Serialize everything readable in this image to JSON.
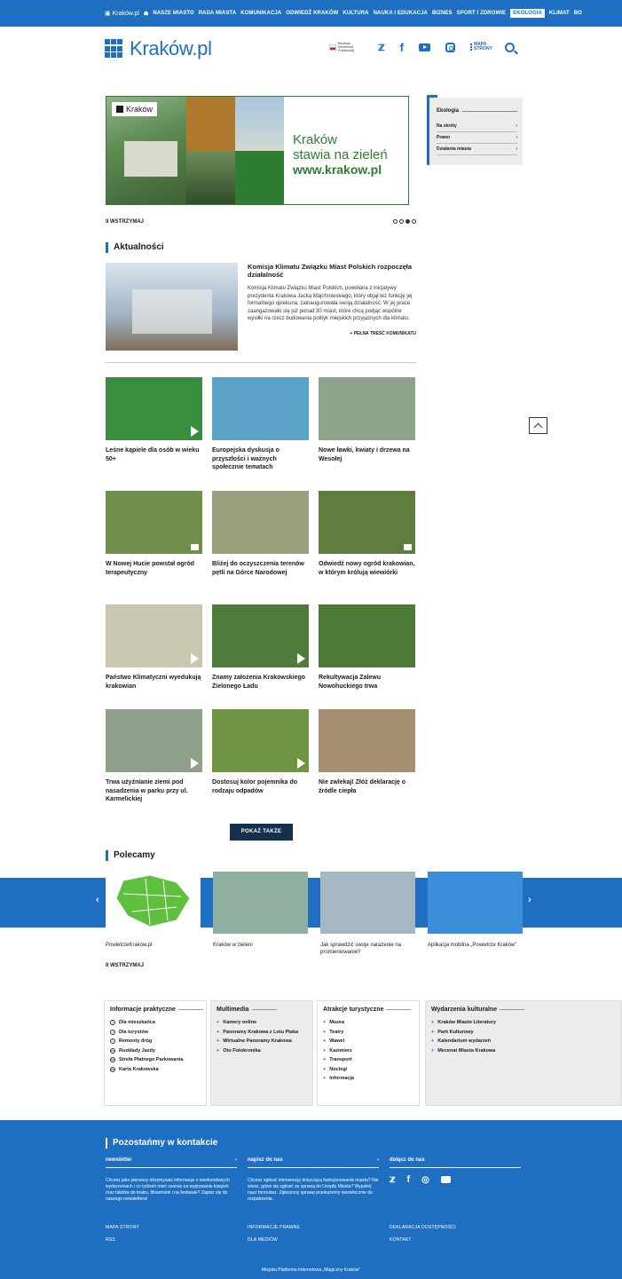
{
  "topnav": {
    "home": "Kraków.pl",
    "items": [
      "NASZE MIASTO",
      "RADA MIASTA",
      "KOMUNIKACJA",
      "ODWIEDŹ KRAKÓW",
      "KULTURA",
      "NAUKA I EDUKACJA",
      "BIZNES",
      "SPORT I ZDROWIE",
      "EKOLOGIA",
      "KLIMAT",
      "BO"
    ],
    "active": "EKOLOGIA"
  },
  "header": {
    "logo": "Kraków.pl",
    "bip": "Biuletyn Informacji Publicznej",
    "mapa": "MAPA STRONY",
    "icons": [
      "bip-icon",
      "twitter-icon",
      "facebook-icon",
      "youtube-icon",
      "instagram-icon",
      "sitemap-icon",
      "search-icon"
    ]
  },
  "banner": {
    "logo": "Kraków",
    "line1": "Kraków",
    "line2": "stawia na zieleń",
    "url": "www.krakow.pl",
    "pause": "II WSTRZYMAJ",
    "dots": 4,
    "active_dot": 3
  },
  "side": {
    "title": "Ekologia",
    "items": [
      "Na skróty",
      "Prawo",
      "Działania miasta"
    ]
  },
  "news": {
    "title": "Aktualności",
    "featured": {
      "title": "Komisja Klimatu Związku Miast Polskich rozpoczęła działalność",
      "text": "Komisja Klimatu Związku Miast Polskich, powołana z inicjatywy prezydenta Krakowa Jacka Majchrowskiego, który objął też funkcję jej formalnego opiekuna, zainaugurowała swoją działalność. W jej prace zaangażowało się już ponad 30 miast, które chcą podjąć wspólne wysiłki na rzecz budowania polityk miejskich przyjaznych dla klimatu.",
      "more": "+ PEŁNA TREŚĆ KOMUNIKATU"
    },
    "tiles": [
      {
        "title": "Leśne kąpiele dla osób w wieku 50+",
        "color": "#3a8d3f",
        "icon": "play"
      },
      {
        "title": "Europejska dyskusja o przyszłości i ważnych społecznie tematach",
        "color": "#5aa3c7",
        "icon": ""
      },
      {
        "title": "Nowe ławki, kwiaty i drzewa na Wesołej",
        "color": "#8ea48a",
        "icon": ""
      },
      {
        "title": "W Nowej Hucie powstał ogród terapeutyczny",
        "color": "#6f8f4a",
        "icon": "cam"
      },
      {
        "title": "Bliżej do oczyszczenia terenów pętli na Górce Narodowej",
        "color": "#9da07e",
        "icon": ""
      },
      {
        "title": "Odwiedź nowy ogród krakowian, w którym królują wiewiórki",
        "color": "#5f7d3d",
        "icon": "cam"
      },
      {
        "title": "Państwo Klimatyczni wyedukują krakowian",
        "color": "#c9c7b0",
        "icon": "play"
      },
      {
        "title": "Znamy założenia Krakowskiego Zielonego Ładu",
        "color": "#4f7b3c",
        "icon": "play"
      },
      {
        "title": "Rekultywacja Zalewu Nowohuckiego trwa",
        "color": "#4c7a34",
        "icon": ""
      },
      {
        "title": "Trwa użyźnianie ziemi pod nasadzenia w parku przy ul. Karmelickiej",
        "color": "#8fa08a",
        "icon": "play"
      },
      {
        "title": "Dostosuj kolor pojemnika do rodzaju odpadów",
        "color": "#6c9443",
        "icon": "play"
      },
      {
        "title": "Nie zwlekaj! Złóż deklarację o źródle ciepła",
        "color": "#a88f70",
        "icon": ""
      }
    ],
    "show_more": "POKAŻ TAKŻE"
  },
  "polecamy": {
    "title": "Polecamy",
    "items": [
      {
        "title": "PowietrzeKraków.pl",
        "color": "#ffffff"
      },
      {
        "title": "Kraków w zieleni",
        "color": "#8fb0a0"
      },
      {
        "title": "Jak sprawdzić swoje narażenie na promieniowanie?",
        "color": "#a6b7c4"
      },
      {
        "title": "Aplikacja mobilna „Powietrze Kraków”",
        "color": "#3b8fd9"
      }
    ],
    "pause": "II WSTRZYMAJ"
  },
  "info": [
    {
      "title": "Informacje praktyczne",
      "items": [
        "Dla mieszkańca",
        "Dla turystów",
        "Remonty dróg",
        "Rozkłady Jazdy",
        "Strefa Płatnego Parkowania",
        "Karta Krakowska"
      ],
      "icons": [
        "info-icon",
        "info-icon",
        "warning-icon",
        "bus-icon",
        "car-icon",
        "card-icon"
      ]
    },
    {
      "title": "Multimedia",
      "items": [
        "Kamery online",
        "Panoramy Krakowa z Lotu Ptaka",
        "Wirtualne Panoramy Krakowa",
        "Oto Fotokronika"
      ]
    },
    {
      "title": "Atrakcje turystyczne",
      "items": [
        "Muzea",
        "Teatry",
        "Wawel",
        "Kazimierz",
        "Transport",
        "Noclegi",
        "Informacja"
      ]
    },
    {
      "title": "Wydarzenia kulturalne",
      "items": [
        "Kraków Miasto Literatury",
        "Park Kulturowy",
        "Kalendarium wydarzeń",
        "Mecenat Miasta Krakowa"
      ]
    }
  ],
  "footer": {
    "title": "Pozostańmy w kontakcie",
    "newsletter": "newsletter",
    "newsletter_text": "Chcesz jako pierwszy otrzymywać informacje o weekendowych wydarzeniach i co tydzień mieć szansę na wygrywanie książek oraz biletów do teatru, filharmonii i na festiwale? Zapisz się do naszego newslettera!",
    "napisz": "napisz do nas",
    "napisz_text": "Chcesz zgłosić interwencję dotyczącą funkcjonowania miasta? Nie wiesz, gdzie się zgłosić ze sprawą do Urzędu Miasta? Wypełnij nasz formularz. Zgłoszony sprawę przekażemy niezwłocznie do rozpatrzenia.",
    "dolacz": "dołącz do nas",
    "links": [
      "MAPA STRONY",
      "RSS",
      "INFORMACJE PRAWNE",
      "DLA MEDIÓW",
      "DEKLARACJA DOSTĘPNOŚCI",
      "KONTAKT"
    ],
    "copyright": "Miejska Platforma Internetowa „Magiczny Kraków”"
  }
}
